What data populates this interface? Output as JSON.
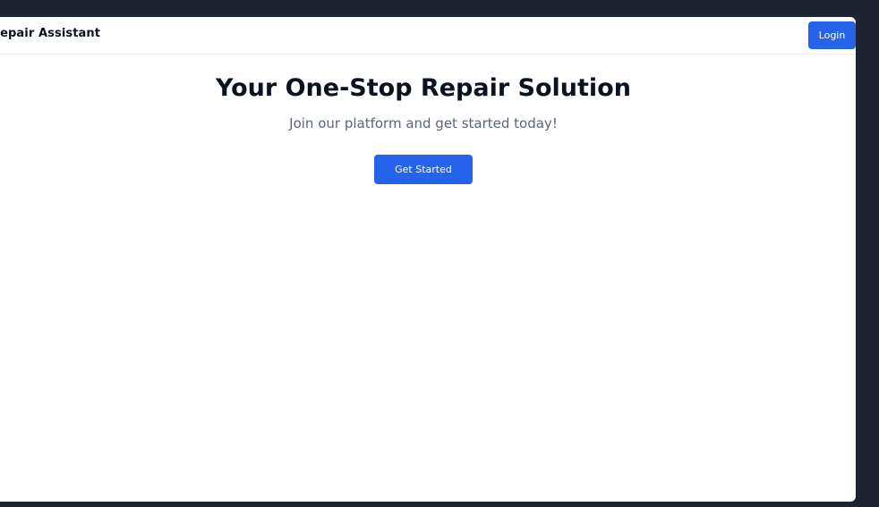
{
  "navbar": {
    "brand": "Repair Assistant",
    "login_label": "Login"
  },
  "hero": {
    "title": "Your One-Stop Repair Solution",
    "subtitle": "Join our platform and get started today!",
    "cta_label": "Get Started"
  },
  "colors": {
    "background": "#1f2433",
    "accent": "#2563eb",
    "heading": "#0b1220",
    "muted": "#5b6472"
  }
}
